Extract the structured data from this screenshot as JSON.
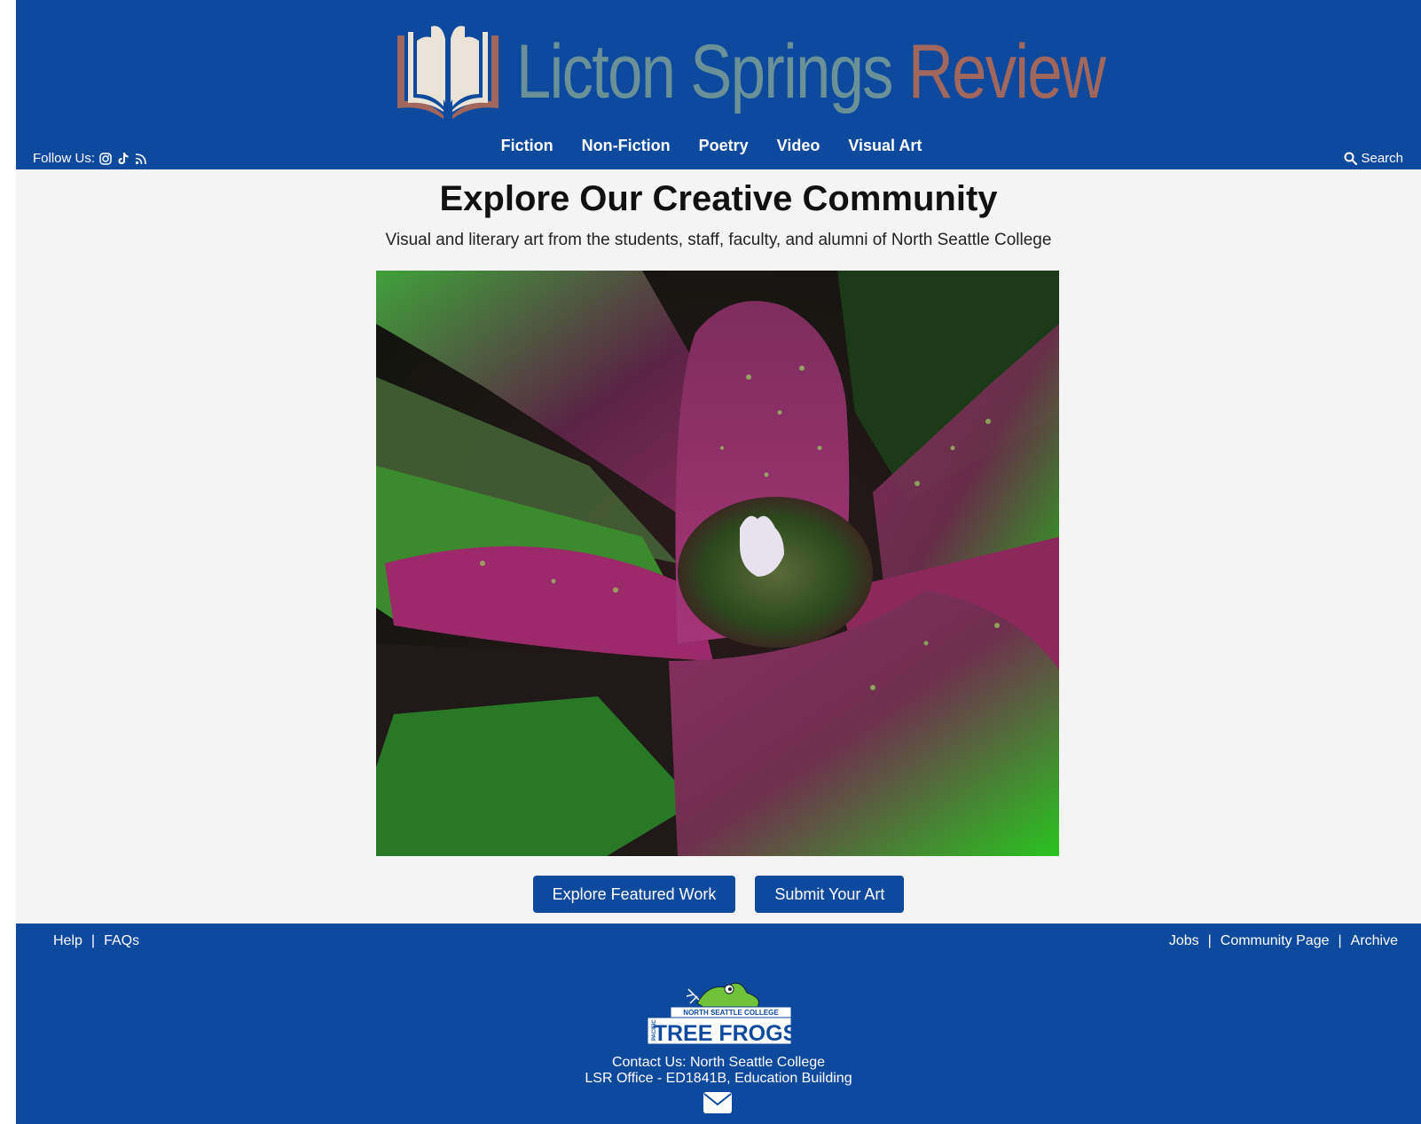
{
  "header": {
    "logo_part1": "Licton Springs",
    "logo_part2": "Review",
    "follow_label": "Follow Us:",
    "social_icons": [
      "instagram-icon",
      "tiktok-icon",
      "rss-icon"
    ],
    "nav": [
      "Fiction",
      "Non-Fiction",
      "Poetry",
      "Video",
      "Visual Art"
    ],
    "search_label": "Search"
  },
  "main": {
    "title": "Explore Our Creative Community",
    "subtitle": "Visual and literary art from the students, staff, faculty, and alumni of North Seattle College",
    "buttons": [
      "Explore Featured Work",
      "Submit Your Art"
    ]
  },
  "footer": {
    "left_links": [
      "Help",
      "FAQs"
    ],
    "right_links": [
      "Jobs",
      "Community Page",
      "Archive"
    ],
    "logo_text": {
      "top": "NORTH SEATTLE COLLEGE",
      "side": "PACIFIC",
      "main": "TREE FROGS"
    },
    "contact_line1": "Contact Us: North Seattle College",
    "contact_line2": "LSR Office - ED1841B, Education Building"
  },
  "colors": {
    "brand_blue": "#0d4a9e",
    "logo_teal": "#6a9197",
    "logo_rust": "#a1675c",
    "page_bg": "#f4f4f4"
  }
}
